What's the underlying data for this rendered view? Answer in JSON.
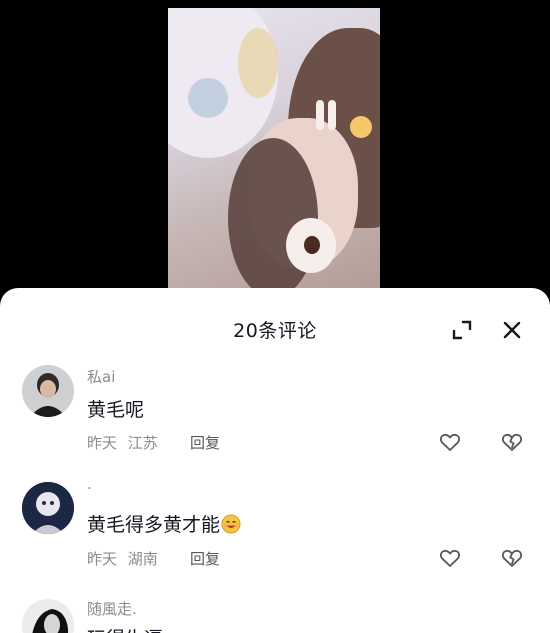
{
  "comments_panel": {
    "title": "20条评论",
    "icons": {
      "expand": "expand-icon",
      "close": "close-icon"
    }
  },
  "comments": [
    {
      "username": "私ai",
      "text": "黄毛呢",
      "time": "昨天",
      "location": "江苏",
      "reply_label": "回复",
      "icons": [
        "heart-icon",
        "broken-heart-icon"
      ]
    },
    {
      "username": ".",
      "text": "黄毛得多黄才能",
      "emoji": "smiling-emoji",
      "time": "昨天",
      "location": "湖南",
      "reply_label": "回复",
      "icons": [
        "heart-icon",
        "broken-heart-icon"
      ]
    },
    {
      "username": "随風走.",
      "text": "玩得生逼"
    }
  ]
}
